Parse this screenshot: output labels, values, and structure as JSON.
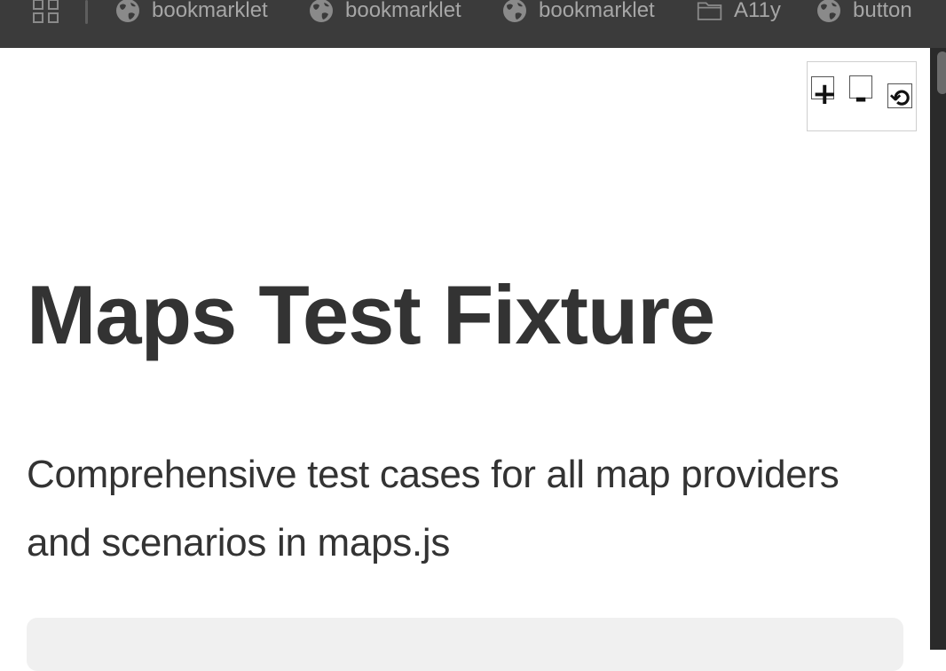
{
  "bookmarks_bar": {
    "apps_icon": "apps-grid-icon",
    "items": [
      {
        "label": "bookmarklet",
        "icon": "globe-icon"
      },
      {
        "label": "bookmarklet",
        "icon": "globe-icon"
      },
      {
        "label": "bookmarklet",
        "icon": "globe-icon"
      },
      {
        "label": "A11y",
        "icon": "folder-icon"
      },
      {
        "label": "button",
        "icon": "globe-icon"
      }
    ]
  },
  "zoom_controls": {
    "zoom_in_label": "+",
    "zoom_out_label": "-",
    "reset_label": "⟲"
  },
  "main": {
    "title": "Maps Test Fixture",
    "subtitle": "Comprehensive test cases for all map providers and scenarios in maps.js"
  },
  "colors": {
    "bar_background": "#3b3b3b",
    "bar_text": "#a6a6a6",
    "heading_text": "#333333",
    "card_background": "#f0f0f0"
  }
}
